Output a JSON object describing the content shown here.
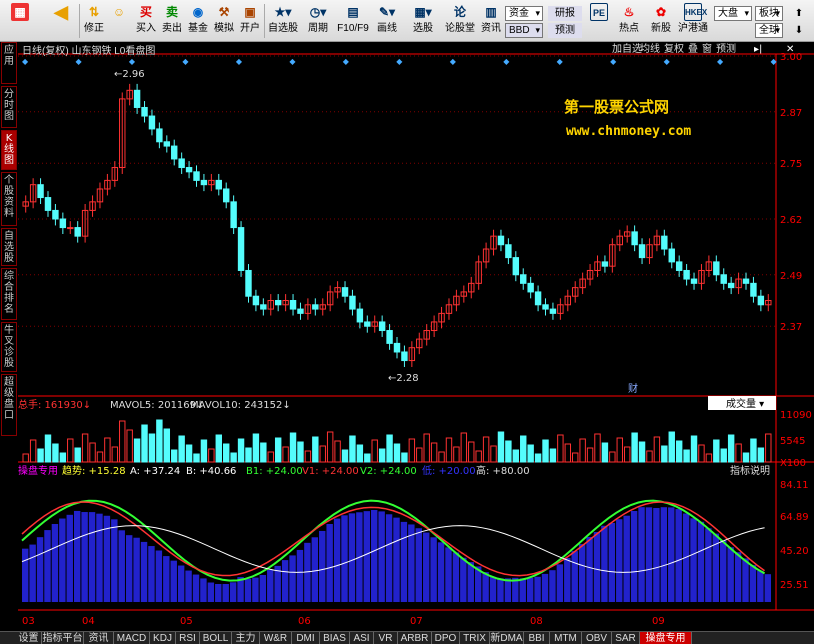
{
  "toolbar": {
    "buttons": [
      {
        "label": "",
        "icon": "grid-icon"
      },
      {
        "label": "",
        "icon": "back-icon"
      },
      {
        "label": "修正",
        "icon": "modify-icon"
      },
      {
        "label": "买入",
        "icon": "buy-icon"
      },
      {
        "label": "卖出",
        "icon": "sell-icon"
      },
      {
        "label": "基金",
        "icon": "fund-icon"
      },
      {
        "label": "模拟",
        "icon": "simulate-icon"
      },
      {
        "label": "开户",
        "icon": "open-account-icon"
      },
      {
        "label": "自选股",
        "icon": "watchlist-icon"
      },
      {
        "label": "周期",
        "icon": "period-icon"
      },
      {
        "label": "F10/F9",
        "icon": "f10-icon"
      },
      {
        "label": "画线",
        "icon": "draw-icon"
      },
      {
        "label": "选股",
        "icon": "select-icon"
      },
      {
        "label": "论股堂",
        "icon": "forum-icon"
      },
      {
        "label": "资讯",
        "icon": "news-icon"
      },
      {
        "label": "热点",
        "icon": "hot-icon"
      },
      {
        "label": "新股",
        "icon": "new-stock-icon"
      },
      {
        "label": "沪港通",
        "icon": "hk-connect-icon"
      }
    ],
    "funds_label": "资金",
    "research_label": "研报",
    "forecast_label": "预测",
    "bbd_label": "BBD",
    "market_label": "大盘",
    "sector_label": "板块",
    "global_label": "全球"
  },
  "left_tabs": [
    "应用",
    "分时图",
    "K线图",
    "个股资料",
    "自选股",
    "综合排名",
    "牛叉诊股",
    "超级盘口"
  ],
  "chart_header": {
    "title": "日线(复权)  山东钢铁  L0看盘图",
    "buttons": [
      "加自选",
      "均线",
      "复权",
      "叠",
      "窗",
      "预测"
    ]
  },
  "watermark": {
    "name": "第一股票公式网",
    "url": "www.chnmoney.com"
  },
  "colors": {
    "up": "#ff3232",
    "down": "#54fcfc",
    "bg": "#000000",
    "grid": "#800000",
    "axis": "#ff0000"
  },
  "chart_data": [
    {
      "type": "candlestick",
      "title": "日线(复权)",
      "ylim": [
        2.24,
        3.0
      ],
      "yticks": [
        "3.00",
        "2.87",
        "2.75",
        "2.62",
        "2.49",
        "2.37"
      ],
      "x_labels": [
        "03",
        "04",
        "05",
        "06",
        "07",
        "08",
        "09"
      ],
      "annotations": [
        "2.96",
        "2.28",
        "财"
      ],
      "closes": [
        2.66,
        2.7,
        2.67,
        2.64,
        2.62,
        2.6,
        2.6,
        2.58,
        2.64,
        2.66,
        2.69,
        2.71,
        2.74,
        2.9,
        2.92,
        2.88,
        2.86,
        2.83,
        2.8,
        2.79,
        2.76,
        2.74,
        2.73,
        2.71,
        2.7,
        2.71,
        2.69,
        2.66,
        2.6,
        2.5,
        2.44,
        2.42,
        2.41,
        2.43,
        2.42,
        2.43,
        2.41,
        2.4,
        2.42,
        2.41,
        2.42,
        2.45,
        2.46,
        2.44,
        2.41,
        2.38,
        2.37,
        2.38,
        2.36,
        2.33,
        2.31,
        2.29,
        2.32,
        2.34,
        2.36,
        2.38,
        2.4,
        2.42,
        2.44,
        2.45,
        2.47,
        2.52,
        2.55,
        2.58,
        2.56,
        2.53,
        2.49,
        2.47,
        2.45,
        2.42,
        2.41,
        2.4,
        2.42,
        2.44,
        2.46,
        2.48,
        2.5,
        2.52,
        2.51,
        2.56,
        2.58,
        2.59,
        2.56,
        2.53,
        2.56,
        2.58,
        2.55,
        2.52,
        2.5,
        2.48,
        2.47,
        2.5,
        2.52,
        2.49,
        2.47,
        2.46,
        2.48,
        2.47,
        2.44,
        2.42,
        2.43
      ]
    },
    {
      "type": "bar",
      "title": "总手",
      "series": [
        {
          "name": "MAVOL5",
          "value": "201169"
        },
        {
          "name": "MAVOL10",
          "value": "243152"
        }
      ],
      "value": "161930",
      "yticks": [
        "11090",
        "5545",
        "X100"
      ],
      "dropdown": "成交量"
    },
    {
      "type": "line",
      "title": "操盘专用",
      "series": [
        {
          "name": "趋势",
          "value": "+15.28"
        },
        {
          "name": "A",
          "value": "+37.24"
        },
        {
          "name": "B",
          "value": "+40.66"
        },
        {
          "name": "B1",
          "value": "+24.00"
        },
        {
          "name": "V1",
          "value": "+24.00"
        },
        {
          "name": "V2",
          "value": "+24.00"
        },
        {
          "name": "低",
          "value": "+20.00"
        },
        {
          "name": "高",
          "value": "+80.00"
        }
      ],
      "yticks": [
        "84.11",
        "64.89",
        "45.20",
        "25.51"
      ],
      "help": "指标说明"
    }
  ],
  "bottom_tabs": [
    "设置",
    "指标平台",
    "资讯",
    "MACD",
    "KDJ",
    "RSI",
    "BOLL",
    "主力",
    "W&R",
    "DMI",
    "BIAS",
    "ASI",
    "VR",
    "ARBR",
    "DPO",
    "TRIX",
    "新DMA",
    "BBI",
    "MTM",
    "OBV",
    "SAR",
    "操盘专用"
  ]
}
